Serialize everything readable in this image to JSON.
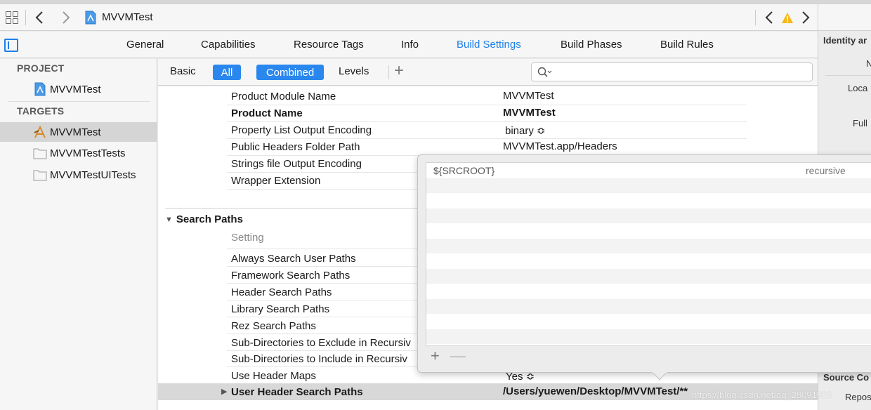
{
  "jumpbar": {
    "title": "MVVMTest"
  },
  "tabs": [
    {
      "label": "General",
      "active": false
    },
    {
      "label": "Capabilities",
      "active": false
    },
    {
      "label": "Resource Tags",
      "active": false
    },
    {
      "label": "Info",
      "active": false
    },
    {
      "label": "Build Settings",
      "active": true
    },
    {
      "label": "Build Phases",
      "active": false
    },
    {
      "label": "Build Rules",
      "active": false
    }
  ],
  "navigator": {
    "project_header": "PROJECT",
    "project_item": "MVVMTest",
    "targets_header": "TARGETS",
    "targets": [
      "MVVMTest",
      "MVVMTestTests",
      "MVVMTestUITests"
    ]
  },
  "filter": {
    "basic": "Basic",
    "all": "All",
    "combined": "Combined",
    "levels": "Levels",
    "add": "+"
  },
  "settings_top": [
    {
      "label": "Product Module Name",
      "value": "MVVMTest",
      "bold": false
    },
    {
      "label": "Product Name",
      "value": "MVVMTest",
      "bold": true
    },
    {
      "label": "Property List Output Encoding",
      "value": "binary ≎",
      "bold": false
    },
    {
      "label": "Public Headers Folder Path",
      "value": "MVVMTest.app/Headers",
      "bold": false
    },
    {
      "label": "Strings file Output Encoding",
      "value": "",
      "bold": false
    },
    {
      "label": "Wrapper Extension",
      "value": "",
      "bold": false
    }
  ],
  "search_paths": {
    "title": "Search Paths",
    "column": "Setting",
    "rows": [
      "Always Search User Paths",
      "Framework Search Paths",
      "Header Search Paths",
      "Library Search Paths",
      "Rez Search Paths",
      "Sub-Directories to Exclude in Recursiv",
      "Sub-Directories to Include in Recursiv",
      "Use Header Maps"
    ],
    "use_header_maps_value": "Yes ≎",
    "user_header_label": "User Header Search Paths",
    "user_header_value": "/Users/yuewen/Desktop/MVVMTest/**"
  },
  "popover": {
    "path": "${SRCROOT}",
    "option": "recursive",
    "add": "+",
    "remove": "—"
  },
  "inspector": {
    "title": "Identity ar",
    "n_label": "N",
    "loc_label": "Loca",
    "full_label": "Full",
    "source_title": "Source Co",
    "repo_label": "Repos"
  },
  "watermark": "https://blog.csdn.net/qq_28091923",
  "colors": {
    "accent": "#1f7fe8",
    "pill": "#2a87ee",
    "warning": "#f5b814"
  }
}
